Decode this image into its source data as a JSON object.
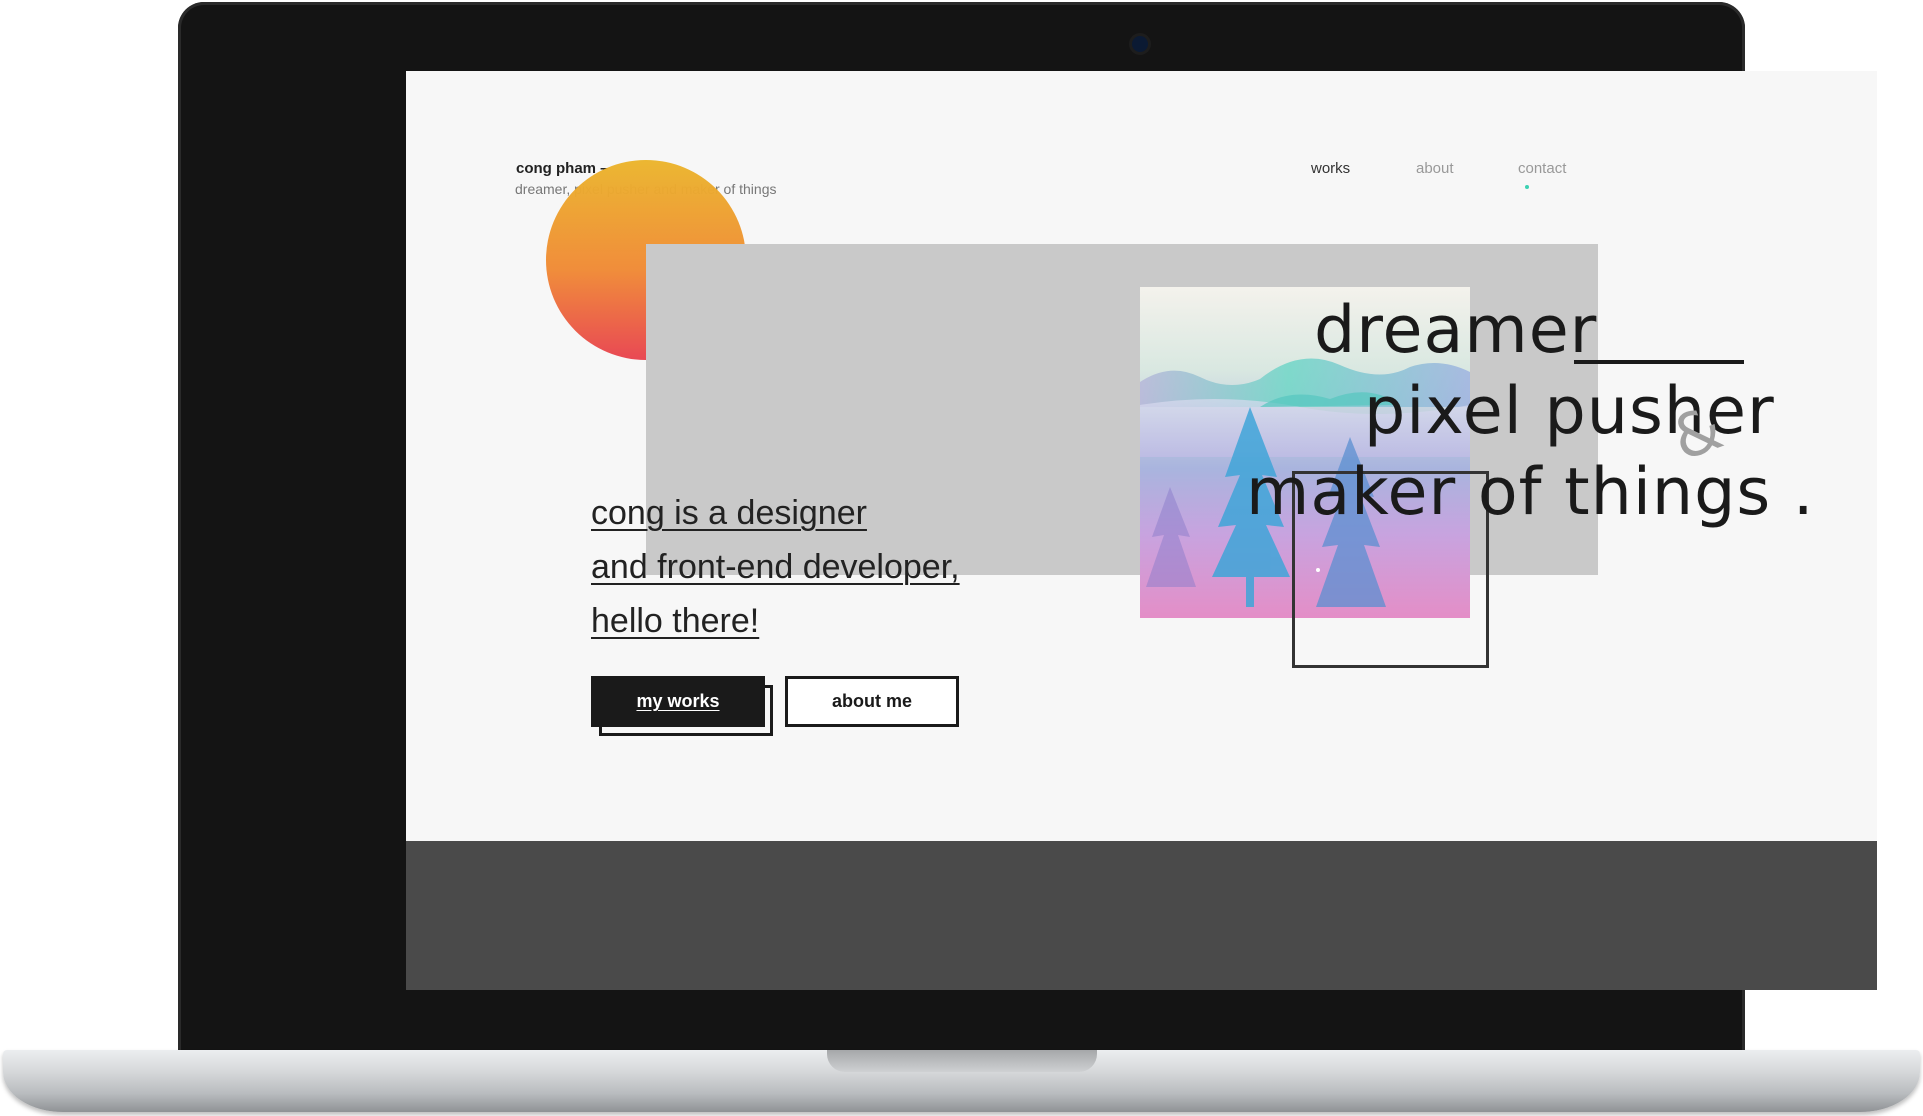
{
  "site": {
    "name": "cong pham –",
    "tagline": "dreamer, pixel pusher and maker of things"
  },
  "nav": {
    "items": [
      {
        "label": "works",
        "active": true
      },
      {
        "label": "about",
        "active": false
      },
      {
        "label": "contact",
        "active": false
      }
    ]
  },
  "hero": {
    "lines": [
      "dreamer",
      "pixel pusher",
      "maker of things ."
    ],
    "ampersand": "&"
  },
  "intro": {
    "lines": [
      "cong is a designer",
      "and front-end developer,",
      "hello there!"
    ]
  },
  "buttons": {
    "primary": "my works",
    "secondary": "about me"
  },
  "colors": {
    "accent_dot": "#3cd1b2",
    "sun_top": "#ebb52c",
    "sun_bottom": "#e8434f",
    "footer": "#4a4a4a"
  }
}
